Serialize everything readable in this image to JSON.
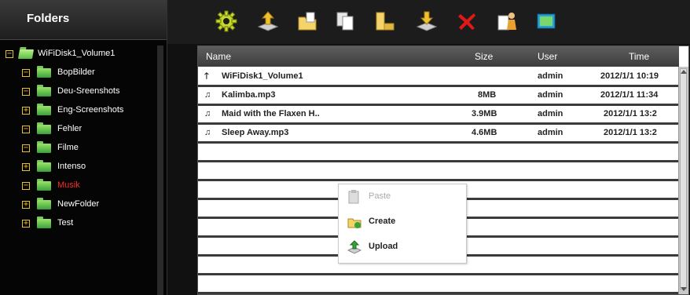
{
  "sidebar": {
    "title": "Folders",
    "root": {
      "label": "WiFiDisk1_Volume1",
      "expanded": true
    },
    "items": [
      {
        "label": "BopBilder",
        "state": "minus",
        "active": false
      },
      {
        "label": "Deu-Sreenshots",
        "state": "minus",
        "active": false
      },
      {
        "label": "Eng-Screenshots",
        "state": "plus",
        "active": false
      },
      {
        "label": "Fehler",
        "state": "minus",
        "active": false
      },
      {
        "label": "Filme",
        "state": "minus",
        "active": false
      },
      {
        "label": "Intenso",
        "state": "plus",
        "active": false
      },
      {
        "label": "Musik",
        "state": "minus",
        "active": true
      },
      {
        "label": "NewFolder",
        "state": "plus",
        "active": false
      },
      {
        "label": "Test",
        "state": "plus",
        "active": false
      }
    ]
  },
  "toolbar": {
    "buttons": [
      {
        "icon": "settings-gear-icon"
      },
      {
        "icon": "upload-icon"
      },
      {
        "icon": "new-folder-icon"
      },
      {
        "icon": "copy-icon"
      },
      {
        "icon": "cut-icon"
      },
      {
        "icon": "download-icon"
      },
      {
        "icon": "delete-icon"
      },
      {
        "icon": "rename-icon"
      },
      {
        "icon": "preview-icon"
      }
    ]
  },
  "table": {
    "headers": {
      "name": "Name",
      "size": "Size",
      "user": "User",
      "time": "Time"
    },
    "rows": [
      {
        "icon": "up-arrow-icon",
        "name": "WiFiDisk1_Volume1",
        "size": "",
        "user": "admin",
        "time": "2012/1/1 10:19"
      },
      {
        "icon": "music-note-icon",
        "name": "Kalimba.mp3",
        "size": "8MB",
        "user": "admin",
        "time": "2012/1/1 11:34"
      },
      {
        "icon": "music-note-icon",
        "name": "Maid with the Flaxen H..",
        "size": "3.9MB",
        "user": "admin",
        "time": "2012/1/1 13:2"
      },
      {
        "icon": "music-note-icon",
        "name": "Sleep Away.mp3",
        "size": "4.6MB",
        "user": "admin",
        "time": "2012/1/1 13:2"
      },
      {
        "icon": "",
        "name": "",
        "size": "",
        "user": "",
        "time": ""
      },
      {
        "icon": "",
        "name": "",
        "size": "",
        "user": "",
        "time": ""
      },
      {
        "icon": "",
        "name": "",
        "size": "",
        "user": "",
        "time": ""
      },
      {
        "icon": "",
        "name": "",
        "size": "",
        "user": "",
        "time": ""
      },
      {
        "icon": "",
        "name": "",
        "size": "",
        "user": "",
        "time": ""
      },
      {
        "icon": "",
        "name": "",
        "size": "",
        "user": "",
        "time": ""
      },
      {
        "icon": "",
        "name": "",
        "size": "",
        "user": "",
        "time": ""
      },
      {
        "icon": "",
        "name": "",
        "size": "",
        "user": "",
        "time": ""
      }
    ]
  },
  "context_menu": {
    "items": [
      {
        "label": "Paste",
        "enabled": false,
        "icon": "paste-icon"
      },
      {
        "label": "Create",
        "enabled": true,
        "icon": "create-folder-icon"
      },
      {
        "label": "Upload",
        "enabled": true,
        "icon": "upload-icon"
      }
    ]
  },
  "colors": {
    "active_folder": "#ff2a2a",
    "expander": "#e6c12c",
    "folder_green": "#3aa23a"
  }
}
